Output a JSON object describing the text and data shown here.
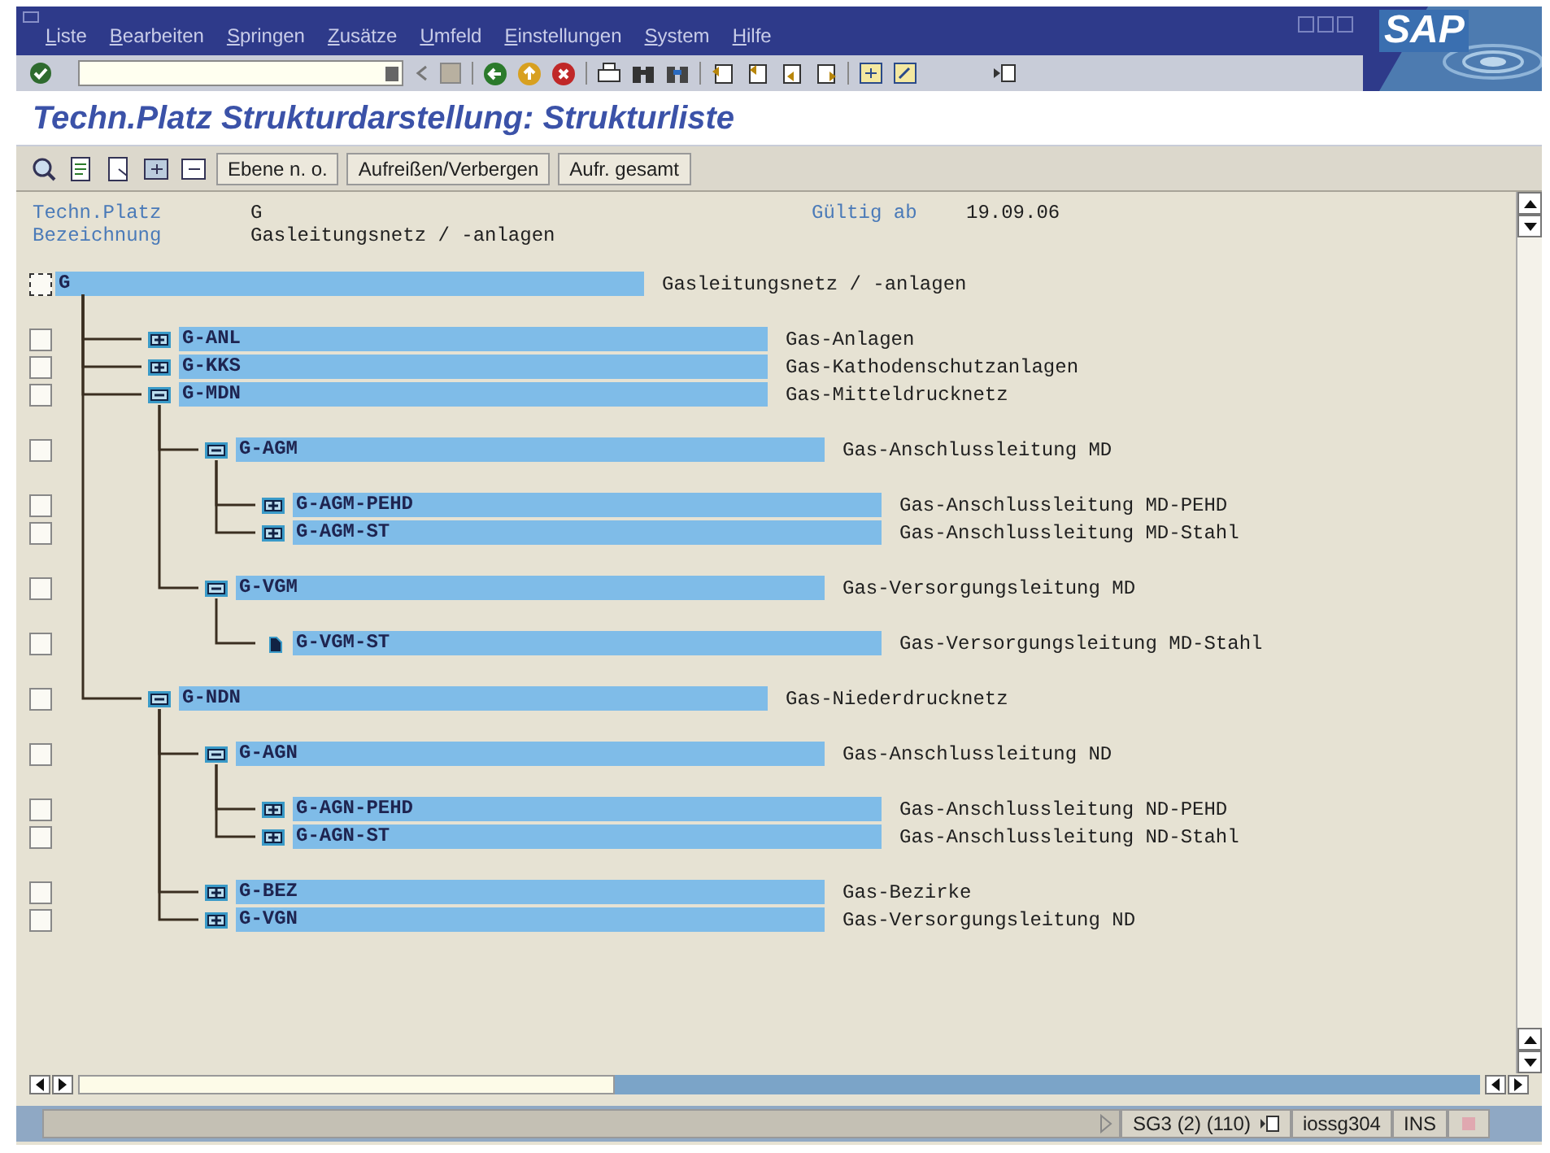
{
  "menu": [
    {
      "label": "Liste"
    },
    {
      "label": "Bearbeiten"
    },
    {
      "label": "Springen"
    },
    {
      "label": "Zusätze"
    },
    {
      "label": "Umfeld"
    },
    {
      "label": "Einstellungen"
    },
    {
      "label": "System"
    },
    {
      "label": "Hilfe"
    }
  ],
  "logo": "SAP",
  "title": "Techn.Platz Strukturdarstellung: Strukturliste",
  "app_toolbar": {
    "buttons": [
      {
        "label": "Ebene n. o."
      },
      {
        "label": "Aufreißen/Verbergen"
      },
      {
        "label": "Aufr. gesamt"
      }
    ]
  },
  "header": {
    "fields": [
      {
        "label": "Techn.Platz",
        "value": "G"
      },
      {
        "label": "Bezeichnung",
        "value": "Gasleitungsnetz / -anlagen"
      }
    ],
    "valid_from": {
      "label": "Gültig ab",
      "value": "19.09.06"
    }
  },
  "tree": [
    {
      "key": "G",
      "description": "Gasleitungsnetz / -anlagen",
      "kind": "root",
      "checked": false,
      "focused": true,
      "children": [
        {
          "key": "G-ANL",
          "description": "Gas-Anlagen",
          "kind": "collapsed",
          "checked": false,
          "focused": false
        },
        {
          "key": "G-KKS",
          "description": "Gas-Kathodenschutzanlagen",
          "kind": "collapsed",
          "checked": false,
          "focused": false
        },
        {
          "key": "G-MDN",
          "description": "Gas-Mitteldrucknetz",
          "kind": "expanded",
          "checked": false,
          "focused": false,
          "children": [
            {
              "key": "G-AGM",
              "description": "Gas-Anschlussleitung MD",
              "kind": "expanded",
              "checked": false,
              "focused": false,
              "children": [
                {
                  "key": "G-AGM-PEHD",
                  "description": "Gas-Anschlussleitung MD-PEHD",
                  "kind": "collapsed",
                  "checked": false,
                  "focused": false
                },
                {
                  "key": "G-AGM-ST",
                  "description": "Gas-Anschlussleitung MD-Stahl",
                  "kind": "collapsed",
                  "checked": false,
                  "focused": false
                }
              ]
            },
            {
              "key": "G-VGM",
              "description": "Gas-Versorgungsleitung MD",
              "kind": "expanded",
              "checked": false,
              "focused": false,
              "children": [
                {
                  "key": "G-VGM-ST",
                  "description": "Gas-Versorgungsleitung MD-Stahl",
                  "kind": "leaf",
                  "checked": false,
                  "focused": false
                }
              ]
            }
          ]
        },
        {
          "key": "G-NDN",
          "description": "Gas-Niederdrucknetz",
          "kind": "expanded",
          "checked": false,
          "focused": false,
          "children": [
            {
              "key": "G-AGN",
              "description": "Gas-Anschlussleitung ND",
              "kind": "expanded",
              "checked": false,
              "focused": false,
              "children": [
                {
                  "key": "G-AGN-PEHD",
                  "description": "Gas-Anschlussleitung ND-PEHD",
                  "kind": "collapsed",
                  "checked": false,
                  "focused": false
                },
                {
                  "key": "G-AGN-ST",
                  "description": "Gas-Anschlussleitung ND-Stahl",
                  "kind": "collapsed",
                  "checked": false,
                  "focused": false
                }
              ]
            },
            {
              "key": "G-BEZ",
              "description": "Gas-Bezirke",
              "kind": "collapsed",
              "checked": false,
              "focused": false
            },
            {
              "key": "G-VGN",
              "description": "Gas-Versorgungsleitung ND",
              "kind": "collapsed",
              "checked": false,
              "focused": false
            }
          ]
        }
      ]
    }
  ],
  "status_bar": {
    "session": "SG3 (2) (110)",
    "server": "iossg304",
    "mode": "INS"
  }
}
